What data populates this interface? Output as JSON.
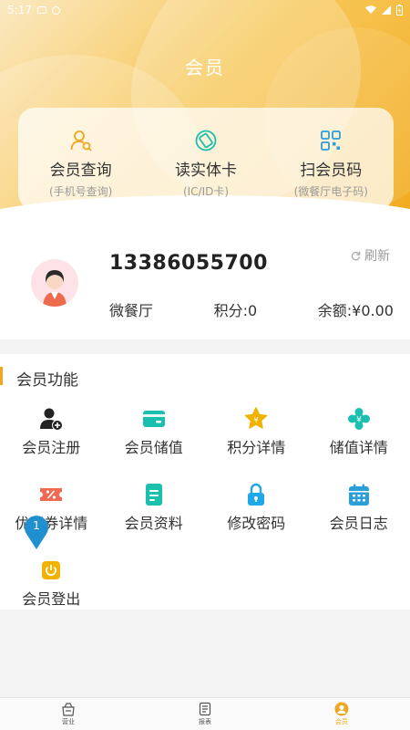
{
  "status_bar": {
    "time": "5:17"
  },
  "header": {
    "title": "会员"
  },
  "quick_actions": [
    {
      "label": "会员查询",
      "sub": "(手机号查询)",
      "icon": "member-search-icon",
      "color": "#f0a61e"
    },
    {
      "label": "读实体卡",
      "sub": "(IC/ID卡)",
      "icon": "card-read-icon",
      "color": "#1bbfae"
    },
    {
      "label": "扫会员码",
      "sub": "(微餐厅电子码)",
      "icon": "qr-scan-icon",
      "color": "#2a9fd8"
    }
  ],
  "profile": {
    "phone": "13386055700",
    "refresh_label": "刷新",
    "store": "微餐厅",
    "points": "积分:0",
    "balance": "余额:¥0.00"
  },
  "functions": {
    "title": "会员功能",
    "items": [
      {
        "label": "会员注册",
        "icon": "user-add-icon",
        "color": "#222222"
      },
      {
        "label": "会员储值",
        "icon": "wallet-card-icon",
        "color": "#1bbfae"
      },
      {
        "label": "积分详情",
        "icon": "points-star-icon",
        "color": "#f0b400"
      },
      {
        "label": "储值详情",
        "icon": "stored-value-icon",
        "color": "#1bbfae"
      },
      {
        "label": "优惠券详情",
        "icon": "coupon-icon",
        "color": "#ef6a52"
      },
      {
        "label": "会员资料",
        "icon": "member-profile-icon",
        "color": "#1bbfae"
      },
      {
        "label": "修改密码",
        "icon": "lock-icon",
        "color": "#1fa8e8"
      },
      {
        "label": "会员日志",
        "icon": "calendar-log-icon",
        "color": "#2a9fd8"
      },
      {
        "label": "会员登出",
        "icon": "power-logout-icon",
        "color": "#f0b400"
      }
    ]
  },
  "marker": {
    "number": "1",
    "color": "#1f8fd0"
  },
  "bottom_nav": [
    {
      "label": "营业",
      "icon": "business-icon",
      "active": false
    },
    {
      "label": "报表",
      "icon": "report-icon",
      "active": false
    },
    {
      "label": "会员",
      "icon": "member-nav-icon",
      "active": true
    }
  ]
}
